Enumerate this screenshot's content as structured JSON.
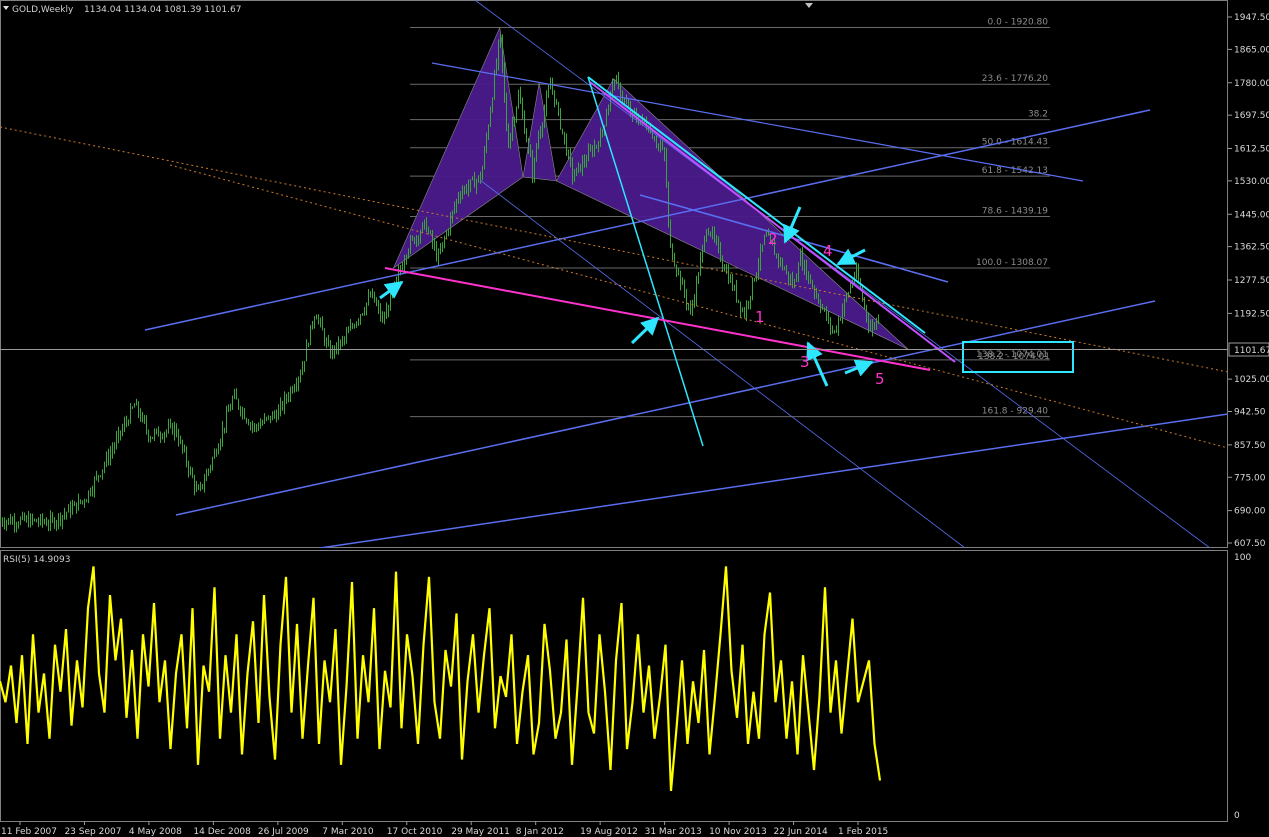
{
  "header": {
    "symbol": "GOLD,Weekly",
    "ohlc": "1134.04 1134.04 1081.39 1101.67"
  },
  "colors": {
    "background": "#000000",
    "candles": "#3aa53a",
    "pattern_fill": "#4a1a8c",
    "trendline": "#5a6ef0",
    "cyan": "#2ee6ff",
    "magenta": "#ff33cc",
    "rsi": "#ffff00",
    "fib": "#6a6a6a",
    "dotted": "#c87a2a"
  },
  "icons": [
    "dropdown-triangle-icon",
    "scroll-marker-icon",
    "cyan-arrow-icon"
  ],
  "price_label": "1101.67",
  "target_box_label": "138.2 - 1074.01",
  "wave_labels": [
    "1",
    "2",
    "3",
    "4",
    "5"
  ],
  "chart_data": [
    {
      "type": "candlestick",
      "title": "GOLD,Weekly",
      "ylim": [
        607.5,
        1947.5
      ],
      "y_ticks": [
        "1947.50",
        "1865.00",
        "1780.00",
        "1697.50",
        "1612.50",
        "1530.00",
        "1445.00",
        "1362.50",
        "1277.50",
        "1192.50",
        "1101.67",
        "1025.00",
        "942.50",
        "857.50",
        "775.00",
        "690.00",
        "607.50"
      ],
      "x_ticks": [
        "11 Feb 2007",
        "23 Sep 2007",
        "4 May 2008",
        "14 Dec 2008",
        "26 Jul 2009",
        "7 Mar 2010",
        "17 Oct 2010",
        "29 May 2011",
        "8 Jan 2012",
        "19 Aug 2012",
        "31 Mar 2013",
        "10 Nov 2013",
        "22 Jun 2014",
        "1 Feb 2015"
      ],
      "close_path": [
        [
          "2007-02-11",
          665
        ],
        [
          "2007-06-01",
          660
        ],
        [
          "2007-09-23",
          720
        ],
        [
          "2007-12-15",
          830
        ],
        [
          "2008-03-15",
          960
        ],
        [
          "2008-05-04",
          880
        ],
        [
          "2008-08-01",
          900
        ],
        [
          "2008-10-20",
          730
        ],
        [
          "2008-12-14",
          830
        ],
        [
          "2009-02-20",
          980
        ],
        [
          "2009-05-01",
          900
        ],
        [
          "2009-07-26",
          940
        ],
        [
          "2009-10-15",
          1050
        ],
        [
          "2009-12-01",
          1200
        ],
        [
          "2010-01-20",
          1090
        ],
        [
          "2010-03-07",
          1120
        ],
        [
          "2010-06-15",
          1240
        ],
        [
          "2010-07-25",
          1170
        ],
        [
          "2010-10-17",
          1360
        ],
        [
          "2010-12-20",
          1420
        ],
        [
          "2011-02-01",
          1330
        ],
        [
          "2011-04-15",
          1500
        ],
        [
          "2011-07-01",
          1540
        ],
        [
          "2011-09-05",
          1900
        ],
        [
          "2011-10-01",
          1620
        ],
        [
          "2011-11-08",
          1750
        ],
        [
          "2011-12-29",
          1540
        ],
        [
          "2012-01-08",
          1620
        ],
        [
          "2012-02-28",
          1780
        ],
        [
          "2012-05-15",
          1540
        ],
        [
          "2012-08-19",
          1640
        ],
        [
          "2012-10-05",
          1790
        ],
        [
          "2012-12-01",
          1700
        ],
        [
          "2013-02-01",
          1670
        ],
        [
          "2013-03-31",
          1590
        ],
        [
          "2013-04-15",
          1370
        ],
        [
          "2013-06-28",
          1190
        ],
        [
          "2013-08-25",
          1420
        ],
        [
          "2013-11-10",
          1280
        ],
        [
          "2013-12-31",
          1190
        ],
        [
          "2014-03-15",
          1390
        ],
        [
          "2014-06-22",
          1260
        ],
        [
          "2014-07-10",
          1340
        ],
        [
          "2014-11-07",
          1140
        ],
        [
          "2015-01-22",
          1300
        ],
        [
          "2015-03-15",
          1150
        ],
        [
          "2015-05-15",
          1225
        ],
        [
          "2015-07-25",
          1090
        ]
      ],
      "fibonacci_levels": [
        {
          "ratio": "0.0",
          "price": 1920.8,
          "label": "0.0 - 1920.80"
        },
        {
          "ratio": "23.6",
          "price": 1776.2,
          "label": "23.6 - 1776.20"
        },
        {
          "ratio": "38.2",
          "price": 1686.0,
          "label": "38.2"
        },
        {
          "ratio": "50.0",
          "price": 1614.43,
          "label": "50.0 - 1614.43"
        },
        {
          "ratio": "61.8",
          "price": 1542.13,
          "label": "61.8 - 1542.13"
        },
        {
          "ratio": "78.6",
          "price": 1439.19,
          "label": "78.6 - 1439.19"
        },
        {
          "ratio": "100.0",
          "price": 1308.07,
          "label": "100.0 - 1308.07"
        },
        {
          "ratio": "138.2",
          "price": 1074.01,
          "label": "138.2 - 1074.01"
        },
        {
          "ratio": "161.8",
          "price": 929.4,
          "label": "161.8 - 929.40"
        }
      ]
    },
    {
      "type": "line",
      "title": "RSI(5) 14.9093",
      "ylim": [
        0,
        100
      ],
      "y_ticks": [
        "100",
        "0"
      ],
      "series": [
        {
          "name": "RSI(5)",
          "values": [
            52,
            44,
            58,
            36,
            62,
            28,
            70,
            40,
            55,
            30,
            66,
            48,
            72,
            35,
            60,
            42,
            80,
            96,
            55,
            40,
            85,
            60,
            76,
            38,
            64,
            30,
            70,
            50,
            82,
            44,
            60,
            26,
            55,
            70,
            34,
            80,
            20,
            58,
            48,
            88,
            30,
            62,
            40,
            70,
            24,
            55,
            75,
            36,
            85,
            46,
            22,
            66,
            92,
            40,
            74,
            30,
            58,
            84,
            28,
            60,
            44,
            72,
            20,
            50,
            90,
            30,
            62,
            44,
            80,
            26,
            56,
            42,
            94,
            34,
            70,
            54,
            28,
            66,
            92,
            44,
            30,
            64,
            50,
            78,
            22,
            52,
            70,
            40,
            62,
            80,
            34,
            54,
            46,
            70,
            28,
            48,
            62,
            24,
            36,
            74,
            56,
            30,
            40,
            68,
            20,
            50,
            84,
            40,
            32,
            70,
            48,
            18,
            60,
            82,
            26,
            44,
            70,
            40,
            58,
            30,
            46,
            66,
            10,
            34,
            60,
            28,
            52,
            36,
            64,
            24,
            46,
            70,
            96,
            56,
            38,
            66,
            28,
            48,
            30,
            70,
            86,
            44,
            60,
            30,
            52,
            24,
            62,
            40,
            18,
            46,
            88,
            40,
            60,
            32,
            54,
            76,
            44,
            52,
            60,
            28,
            14
          ]
        }
      ]
    }
  ]
}
